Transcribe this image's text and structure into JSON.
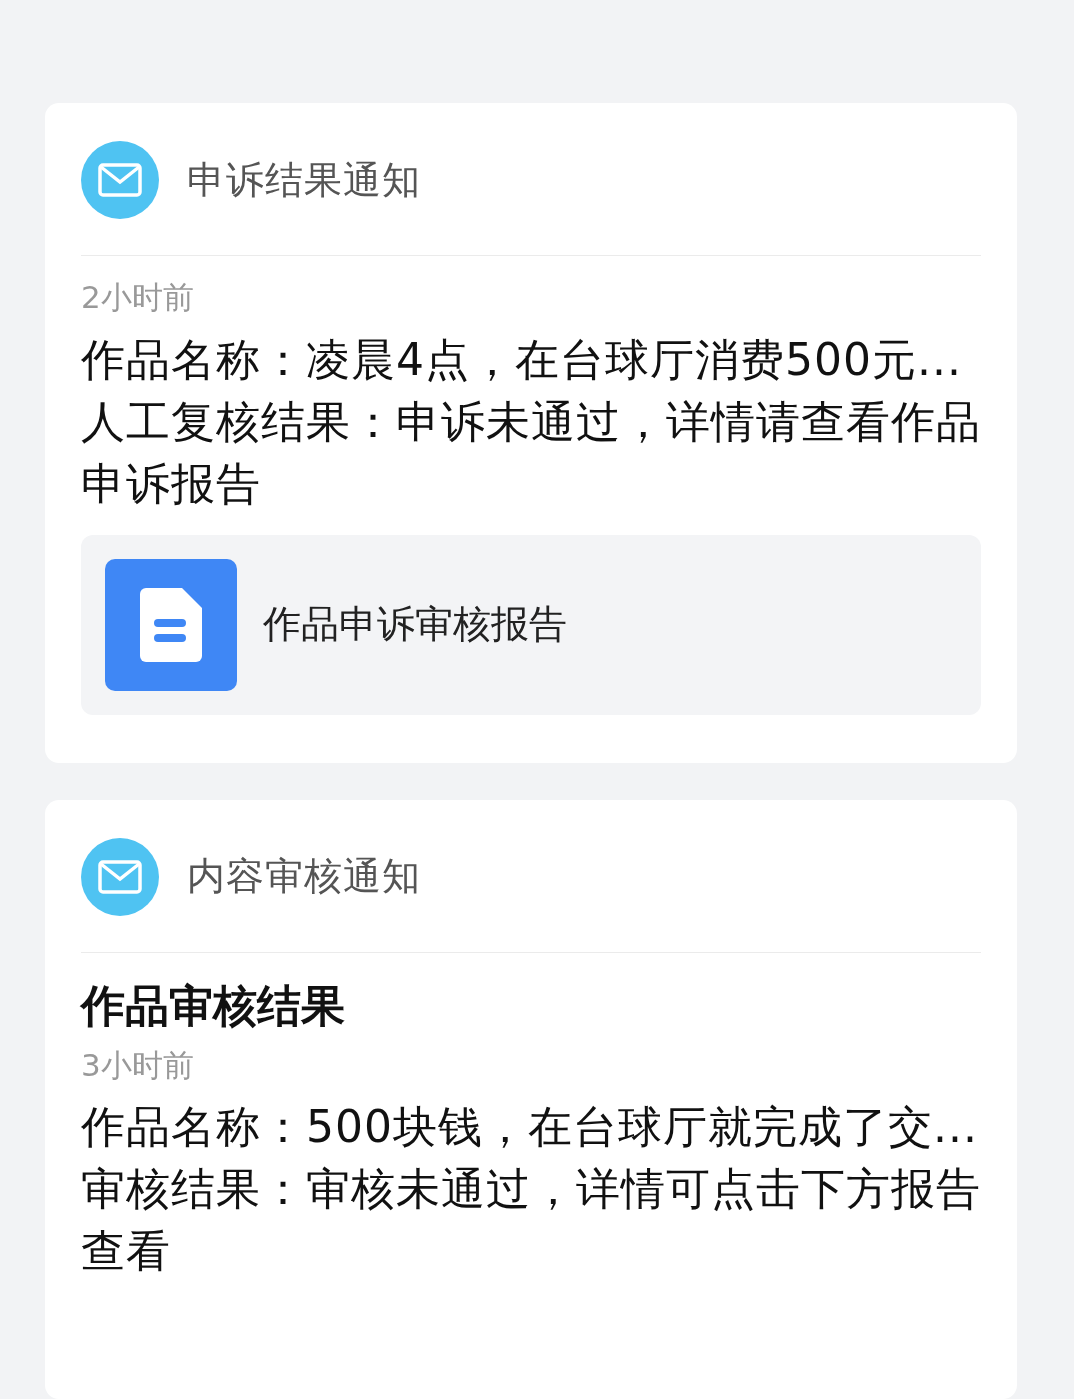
{
  "notifications": [
    {
      "title": "申诉结果通知",
      "time": "2小时前",
      "lines": [
        "作品名称：凌晨4点，在台球厅消费500元...",
        "人工复核结果：申诉未通过，详情请查看作品申诉报告"
      ],
      "report": {
        "label": "作品申诉审核报告"
      }
    },
    {
      "title": "内容审核通知",
      "heading": "作品审核结果",
      "time": "3小时前",
      "lines": [
        "作品名称：500块钱，在台球厅就完成了交...",
        "审核结果：审核未通过，详情可点击下方报告查看"
      ]
    }
  ]
}
